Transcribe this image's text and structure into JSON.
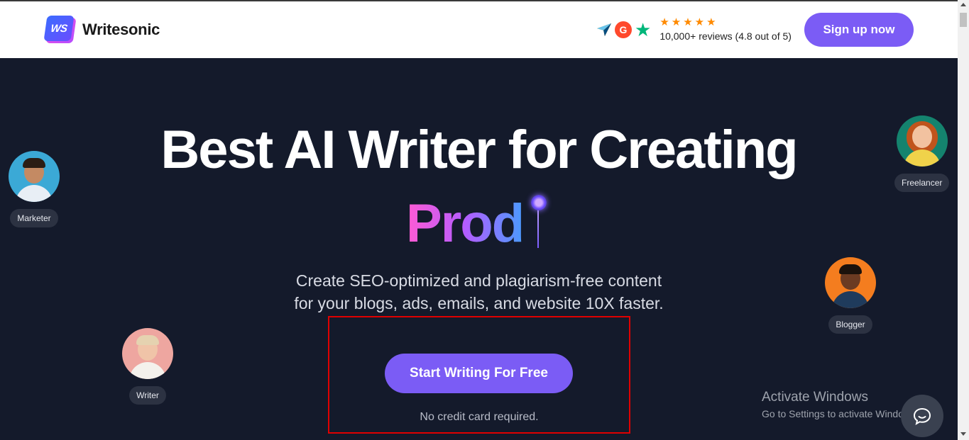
{
  "header": {
    "logo_mark": "WS",
    "logo_text": "Writesonic",
    "ratings": {
      "stars": "★★★★★",
      "reviews_text": "10,000+ reviews (4.8 out of 5)",
      "rating_value": 4.8,
      "g2_label": "G",
      "icons": [
        "capterra-icon",
        "g2-icon",
        "trustpilot-icon"
      ]
    },
    "signup_label": "Sign up now"
  },
  "hero": {
    "title": "Best AI Writer for Creating",
    "typed_word": "Prod",
    "subtitle_line1": "Create SEO-optimized and plagiarism-free content",
    "subtitle_line2": "for your blogs, ads, emails, and website 10X faster.",
    "cta_label": "Start Writing For Free",
    "cta_note": "No credit card required."
  },
  "personas": {
    "marketer": "Marketer",
    "writer": "Writer",
    "freelancer": "Freelancer",
    "blogger": "Blogger"
  },
  "watermark": {
    "title": "Activate Windows",
    "subtitle": "Go to Settings to activate Windows."
  },
  "colors": {
    "accent": "#7b5cf5",
    "hero_bg": "#141a2b",
    "star": "#ff8a00",
    "highlight_box": "#e00000"
  }
}
